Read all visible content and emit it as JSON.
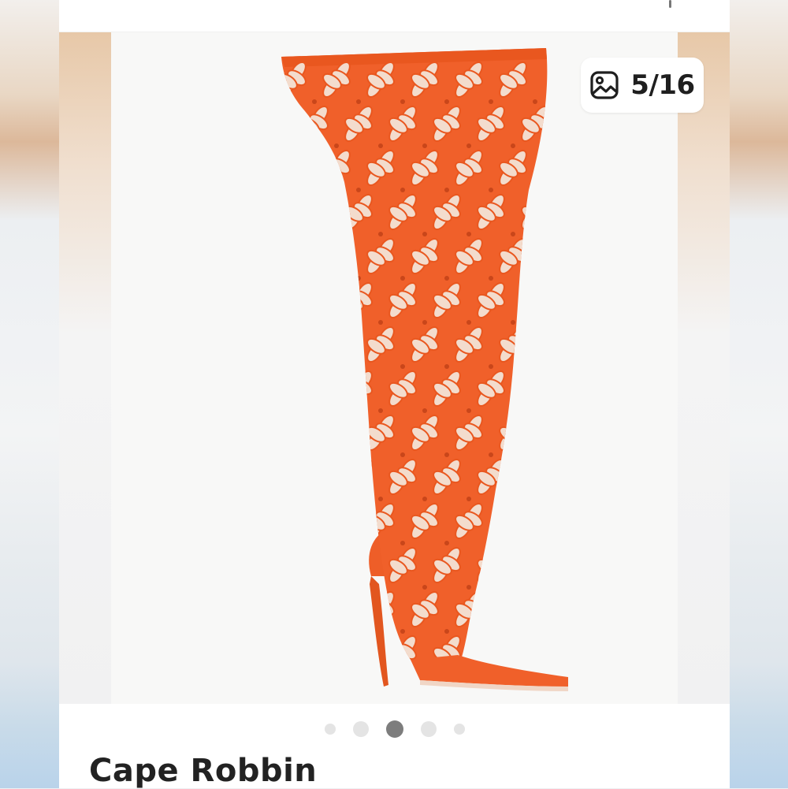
{
  "image_counter": {
    "icon": "image-gallery-icon",
    "text": "5/16"
  },
  "carousel": {
    "dot_count": 5,
    "active_index": 2
  },
  "product": {
    "title": "Cape Robbin"
  },
  "colors": {
    "boot": "#f0602a",
    "boot_dark": "#d9501e",
    "cutout": "#f3dccd",
    "accent_active_dot": "#7d7d7d"
  }
}
